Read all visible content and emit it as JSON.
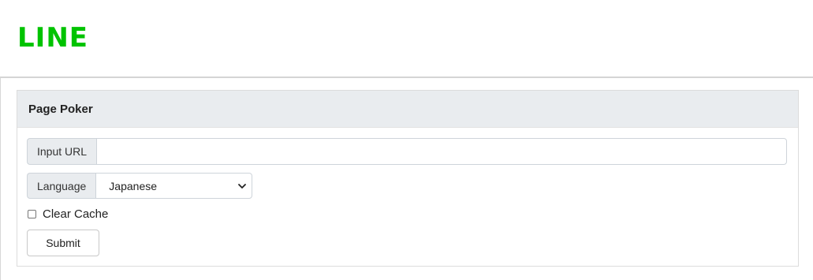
{
  "header": {
    "logo_text": "LINE",
    "brand_color": "#00c300"
  },
  "panel": {
    "title": "Page Poker",
    "url": {
      "label": "Input URL",
      "value": "",
      "placeholder": ""
    },
    "language": {
      "label": "Language",
      "selected": "Japanese",
      "icon": "chevron-down-icon"
    },
    "clear_cache": {
      "label": "Clear Cache",
      "checked": false
    },
    "submit_label": "Submit"
  },
  "colors": {
    "panel_header_bg": "#e9ecef",
    "border": "#ced4da"
  }
}
